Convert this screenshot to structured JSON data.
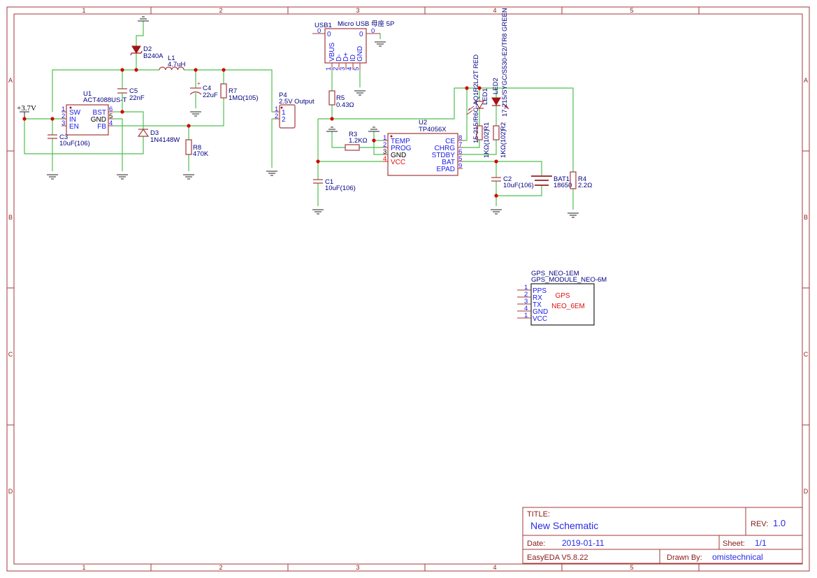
{
  "sheet": {
    "columns": [
      "1",
      "2",
      "3",
      "4",
      "5"
    ],
    "rows": [
      "A",
      "B",
      "C",
      "D"
    ]
  },
  "title_block": {
    "title_label": "TITLE:",
    "title": "New Schematic",
    "rev_label": "REV:",
    "rev": "1.0",
    "date_label": "Date:",
    "date": "2019-01-11",
    "sheet_label": "Sheet:",
    "sheet": "1/1",
    "software": "EasyEDA V5.8.22",
    "drawn_by_label": "Drawn By:",
    "drawn_by": "omistechnical"
  },
  "power": {
    "vin": "+3.7V"
  },
  "colors": {
    "wire": "#4fbf4f",
    "component": "#a33a3a",
    "junction": "#d40000",
    "pin_text": "#1a1ae6",
    "label": "#000080"
  },
  "components": {
    "D2": {
      "ref": "D2",
      "value": "B240A"
    },
    "L1": {
      "ref": "L1",
      "value": "4.7uH"
    },
    "C5": {
      "ref": "C5",
      "value": "22nF"
    },
    "C4": {
      "ref": "C4",
      "value": "22uF",
      "polarity": "+"
    },
    "R7": {
      "ref": "R7",
      "value": "1MΩ(105)"
    },
    "U1": {
      "ref": "U1",
      "value": "ACT4088US-T",
      "pins": [
        {
          "num": "1",
          "name": "SW"
        },
        {
          "num": "2",
          "name": "IN"
        },
        {
          "num": "3",
          "name": "EN"
        },
        {
          "num": "6",
          "name": "BST"
        },
        {
          "num": "5",
          "name": "GND"
        },
        {
          "num": "4",
          "name": "FB"
        }
      ]
    },
    "C3": {
      "ref": "C3",
      "value": "10uF(106)"
    },
    "D3": {
      "ref": "D3",
      "value": "1N4148W"
    },
    "R8": {
      "ref": "R8",
      "value": "470K"
    },
    "P4": {
      "ref": "P4",
      "value": "2.5V Output",
      "pins": [
        {
          "num": "1",
          "name": "1"
        },
        {
          "num": "2",
          "name": "2"
        }
      ]
    },
    "USB1": {
      "ref": "USB1",
      "value": "Micro USB 母座 5P",
      "shell_pins": [
        {
          "num": "0",
          "name": "0"
        },
        {
          "num": "0",
          "name": "0"
        }
      ],
      "pins": [
        {
          "num": "1",
          "name": "VBUS"
        },
        {
          "num": "2",
          "name": "D-"
        },
        {
          "num": "3",
          "name": "D+"
        },
        {
          "num": "4",
          "name": "ID"
        },
        {
          "num": "5",
          "name": "GND"
        }
      ]
    },
    "R5": {
      "ref": "R5",
      "value": "0.43Ω"
    },
    "U2": {
      "ref": "U2",
      "value": "TP4056X",
      "pins": [
        {
          "num": "1",
          "name": "TEMP"
        },
        {
          "num": "2",
          "name": "PROG"
        },
        {
          "num": "3",
          "name": "GND"
        },
        {
          "num": "4",
          "name": "VCC"
        },
        {
          "num": "8",
          "name": "CE"
        },
        {
          "num": "7",
          "name": "CHRG"
        },
        {
          "num": "6",
          "name": "STDBY"
        },
        {
          "num": "5",
          "name": "BAT"
        },
        {
          "num": "9",
          "name": "EPAD"
        }
      ]
    },
    "R3": {
      "ref": "R3",
      "value": "1.2KΩ"
    },
    "C1": {
      "ref": "C1",
      "value": "10uF(106)"
    },
    "LED1": {
      "ref": "LED1",
      "value": "15-215/R6C-AQ1R2L/2T RED"
    },
    "LED2": {
      "ref": "LED2",
      "value": "17-215/SYGC/S530-E2/TR8 GREEN"
    },
    "R1": {
      "ref": "R1",
      "value": "1KΩ(102)"
    },
    "R2": {
      "ref": "R2",
      "value": "1KΩ(102)"
    },
    "C2": {
      "ref": "C2",
      "value": "10uF(106)"
    },
    "BAT1": {
      "ref": "BAT1",
      "value": "18650"
    },
    "R4": {
      "ref": "R4",
      "value": "2.2Ω"
    },
    "GPS": {
      "ref": "GPS_NEO-1EM",
      "value": "GPS_MODULE_NEO-6M",
      "body_line1": "GPS",
      "body_line2": "NEO_6EM",
      "pins": [
        {
          "num": "1",
          "name": "PPS"
        },
        {
          "num": "2",
          "name": "RX"
        },
        {
          "num": "3",
          "name": "TX"
        },
        {
          "num": "4",
          "name": "GND"
        },
        {
          "num": "1",
          "name": "VCC"
        }
      ]
    }
  }
}
